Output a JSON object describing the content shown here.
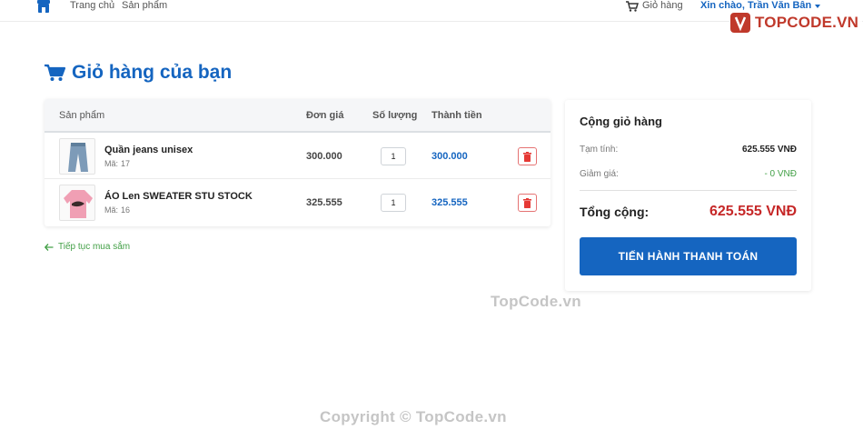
{
  "nav": {
    "home": "Trang chủ",
    "products": "Sản phẩm",
    "cart": "Giỏ hàng",
    "user_greeting": "Xin chào, Trần Văn Bân"
  },
  "logo": {
    "text": "TOPCODE.VN"
  },
  "page": {
    "title": "Giỏ hàng của bạn"
  },
  "cart": {
    "headers": {
      "product": "Sản phẩm",
      "price": "Đơn giá",
      "quantity": "Số lượng",
      "total": "Thành tiền"
    },
    "code_prefix": "Mã:",
    "items": [
      {
        "name": "Quần jeans unisex",
        "code": "17",
        "price": "300.000",
        "quantity": "1",
        "total": "300.000",
        "thumb": "jeans-icon"
      },
      {
        "name": "ÁO Len SWEATER STU STOCK",
        "code": "16",
        "price": "325.555",
        "quantity": "1",
        "total": "325.555",
        "thumb": "sweater-icon"
      }
    ],
    "continue_label": "Tiếp tục mua sắm"
  },
  "summary": {
    "title": "Cộng giỏ hàng",
    "subtotal_label": "Tạm tính:",
    "subtotal_value": "625.555 VNĐ",
    "discount_label": "Giảm giá:",
    "discount_value": "- 0 VNĐ",
    "total_label": "Tổng cộng:",
    "total_value": "625.555 VNĐ",
    "checkout_label": "TIẾN HÀNH THANH TOÁN"
  },
  "watermarks": {
    "center": "TopCode.vn",
    "copyright": "Copyright © TopCode.vn"
  },
  "colors": {
    "primary": "#1565c0",
    "danger": "#c62828",
    "success": "#43a047"
  }
}
